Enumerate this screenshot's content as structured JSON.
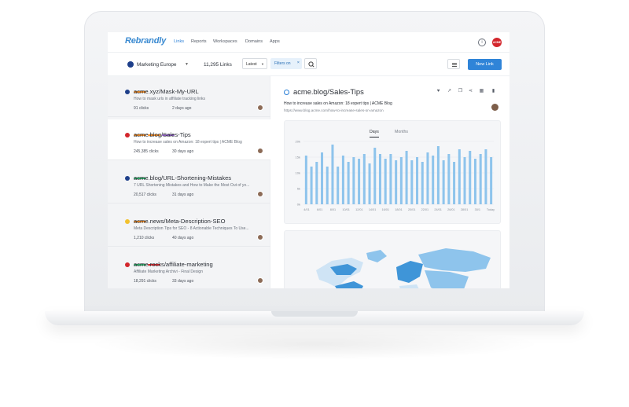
{
  "app": {
    "logo": "Rebrandly",
    "nav": [
      "Links",
      "Reports",
      "Workspaces",
      "Domains",
      "Apps"
    ],
    "active_nav": "Links",
    "info_icon": "i",
    "account_badge": "ACME"
  },
  "toolbar": {
    "workspace": "Marketing Europe",
    "links_count": "11,295 Links",
    "sort": "Latest",
    "filter_chip": "Filters on",
    "new_link": "New Link"
  },
  "links": [
    {
      "title": "acme.xyz/Mask-My-URL",
      "description": "How to mask urls in affiliate tracking links",
      "clicks": "91 clicks",
      "date": "2 days ago",
      "tags": [
        "#f08a24"
      ],
      "favicon_color": "#1e3f8a",
      "selected": false
    },
    {
      "title": "acme.blog/Sales-Tips",
      "description": "How to increase sales on Amazon: 18 expert tips | ACME Blog",
      "clicks": "245,385 clicks",
      "date": "30 days ago",
      "tags": [
        "#f08a24",
        "#f08a24",
        "#8e5bc2"
      ],
      "favicon_color": "#d3262c",
      "selected": true
    },
    {
      "title": "acme.blog/URL-Shortening-Mistakes",
      "description": "7 URL Shortening Mistakes and How to Make the Most Out of yo...",
      "clicks": "20,517 clicks",
      "date": "31 days ago",
      "tags": [
        "#2fb36a"
      ],
      "favicon_color": "#1e3f8a",
      "selected": false
    },
    {
      "title": "acme.news/Meta-Description-SEO",
      "description": "Meta Description Tips for SEO - 8 Actionable Techniques To Use...",
      "clicks": "1,210 clicks",
      "date": "40 days ago",
      "tags": [
        "#f08a24"
      ],
      "favicon_color": "#f2c12e",
      "selected": false
    },
    {
      "title": "acme.rocks/affiliate-marketing",
      "description": "Affiliate Marketing Archivi - Final Design",
      "clicks": "18,291 clicks",
      "date": "33 days ago",
      "tags": [
        "#2fb36a",
        "#d3262c"
      ],
      "favicon_color": "#d3262c",
      "selected": false
    }
  ],
  "detail": {
    "title": "acme.blog/Sales-Tips",
    "description": "How to increase sales on Amazon: 18 expert tips | ACME Blog",
    "url": "https://www.blog.acme.com/how-to-increase-sales-on-amazon",
    "actions": [
      "favorite-icon",
      "open-external-icon",
      "copy-icon",
      "share-icon",
      "qr-code-icon",
      "delete-icon"
    ],
    "tabs": [
      "Days",
      "Months"
    ],
    "active_tab": "Days"
  },
  "chart_data": {
    "type": "bar",
    "x_ticks": [
      "4/01",
      "6/01",
      "8/01",
      "10/01",
      "12/01",
      "14/01",
      "16/01",
      "18/01",
      "20/01",
      "22/01",
      "24/01",
      "26/01",
      "28/01",
      "30/1",
      "Today"
    ],
    "y_ticks": [
      "20k",
      "15k",
      "10k",
      "5k",
      "0k"
    ],
    "ylim": [
      0,
      20000
    ],
    "values": [
      15500,
      12000,
      13500,
      16500,
      12000,
      19000,
      12000,
      15500,
      13500,
      15000,
      14500,
      16000,
      13000,
      18000,
      16000,
      14500,
      16000,
      14000,
      15000,
      17000,
      14000,
      15000,
      13500,
      16500,
      15500,
      18500,
      14000,
      16000,
      13500,
      17500,
      15000,
      17000,
      14500,
      16000,
      17500,
      15000
    ],
    "bar_color": "#8ec4ec"
  },
  "map_colors": {
    "light": "#cfe4f5",
    "mid": "#8ec4ec",
    "dark": "#3f95d8"
  }
}
